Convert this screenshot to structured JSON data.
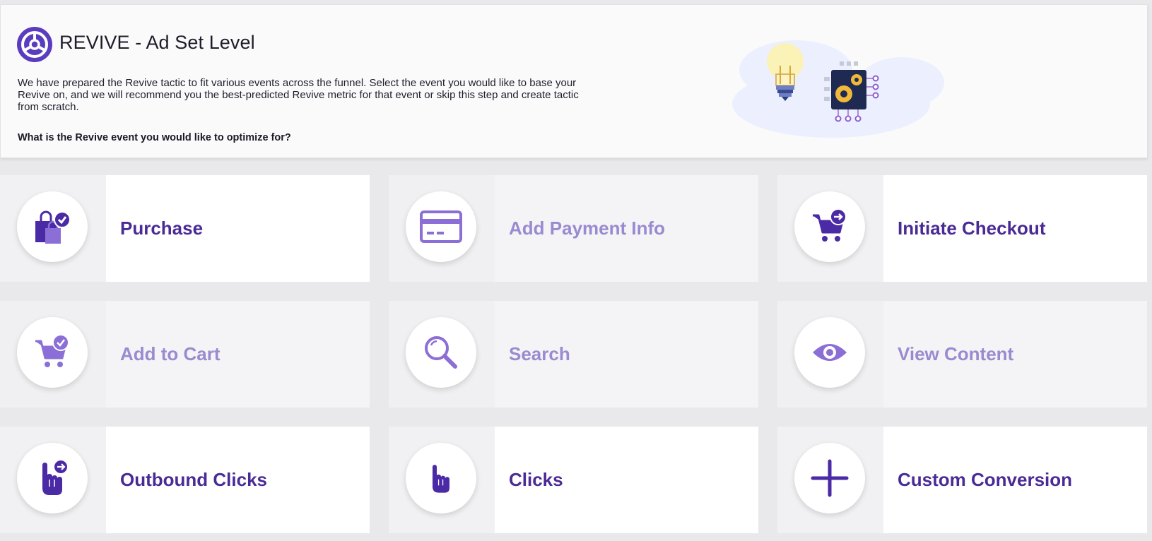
{
  "header": {
    "title": "REVIVE - Ad Set Level",
    "description": "We have prepared the Revive tactic to fit various events across the funnel. Select the event you would like to base your Revive on, and we will recommend you the best-predicted Revive metric for that event or skip this step and create tactic from scratch.",
    "question": "What is the Revive event you would like to optimize for?"
  },
  "events": [
    {
      "label": "Purchase",
      "icon": "shopping-bag-check-icon",
      "state": "active"
    },
    {
      "label": "Add Payment Info",
      "icon": "credit-card-icon",
      "state": "dim"
    },
    {
      "label": "Initiate Checkout",
      "icon": "cart-arrow-icon",
      "state": "active"
    },
    {
      "label": "Add to Cart",
      "icon": "cart-check-icon",
      "state": "dim"
    },
    {
      "label": "Search",
      "icon": "magnifier-icon",
      "state": "dim"
    },
    {
      "label": "View Content",
      "icon": "eye-icon",
      "state": "dim"
    },
    {
      "label": "Outbound Clicks",
      "icon": "hand-arrow-icon",
      "state": "active"
    },
    {
      "label": "Clicks",
      "icon": "hand-pointer-icon",
      "state": "active"
    },
    {
      "label": "Custom Conversion",
      "icon": "plus-icon",
      "state": "active"
    }
  ],
  "colors": {
    "primary": "#4a2b96",
    "dim_label": "#9a8ad0",
    "icon_dark": "#4b2aa6",
    "icon_light": "#8c6fd6"
  }
}
